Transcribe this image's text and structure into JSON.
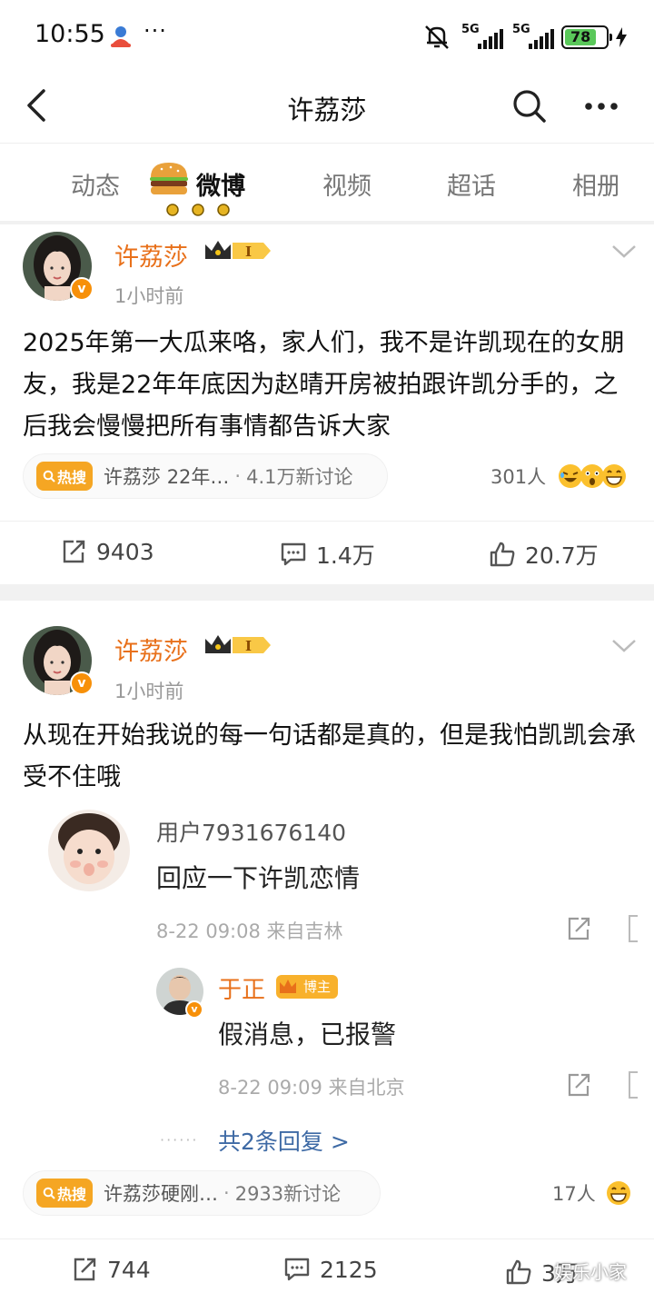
{
  "status_bar": {
    "time": "10:55",
    "dots": "···",
    "network_1": "5G",
    "network_2": "5G",
    "battery": "78",
    "battery_color": "#5ac85a"
  },
  "nav": {
    "title": "许荔莎",
    "back_icon": "chevron-left-icon",
    "search_icon": "search-icon",
    "more_icon": "more-icon"
  },
  "tabs": [
    {
      "label": "动态",
      "active": false
    },
    {
      "label": "微博",
      "active": true
    },
    {
      "label": "视频",
      "active": false
    },
    {
      "label": "超话",
      "active": false
    },
    {
      "label": "相册",
      "active": false
    }
  ],
  "posts": [
    {
      "author": "许荔莎",
      "rank": "I",
      "time": "1小时前",
      "text": "2025年第一大瓜来咯，家人们，我不是许凯现在的女朋友，我是22年年底因为赵晴开房被拍跟许凯分手的，之后我会慢慢把所有事情都告诉大家",
      "hot": {
        "tag": "热搜",
        "title": "许荔莎 22年…",
        "dot": "·",
        "count": "4.1万新讨论"
      },
      "reactors": "301人",
      "actions": {
        "repost": "9403",
        "comment": "1.4万",
        "like": "20.7万"
      }
    },
    {
      "author": "许荔莎",
      "rank": "I",
      "time": "1小时前",
      "text": "从现在开始我说的每一句话都是真的，但是我怕凯凯会承受不住哦",
      "comment": {
        "user": "用户7931676140",
        "text": "回应一下许凯恋情",
        "meta": "8-22 09:08 来自吉林",
        "reply": {
          "user": "于正",
          "badge": "博主",
          "text": "假消息，已报警",
          "meta": "8-22 09:09 来自北京"
        },
        "dashes": "······",
        "more": "共2条回复 >"
      },
      "hot": {
        "tag": "热搜",
        "title": "许荔莎硬刚…",
        "dot": "·",
        "count": "2933新讨论"
      },
      "reactors": "17人",
      "actions": {
        "repost": "744",
        "comment": "2125",
        "like": "3万"
      }
    }
  ],
  "watermark": "娱乐小家",
  "colors": {
    "accent": "#e8701a",
    "hot": "#f5a623",
    "link": "#3e6aa5",
    "verified": "#f79009"
  }
}
